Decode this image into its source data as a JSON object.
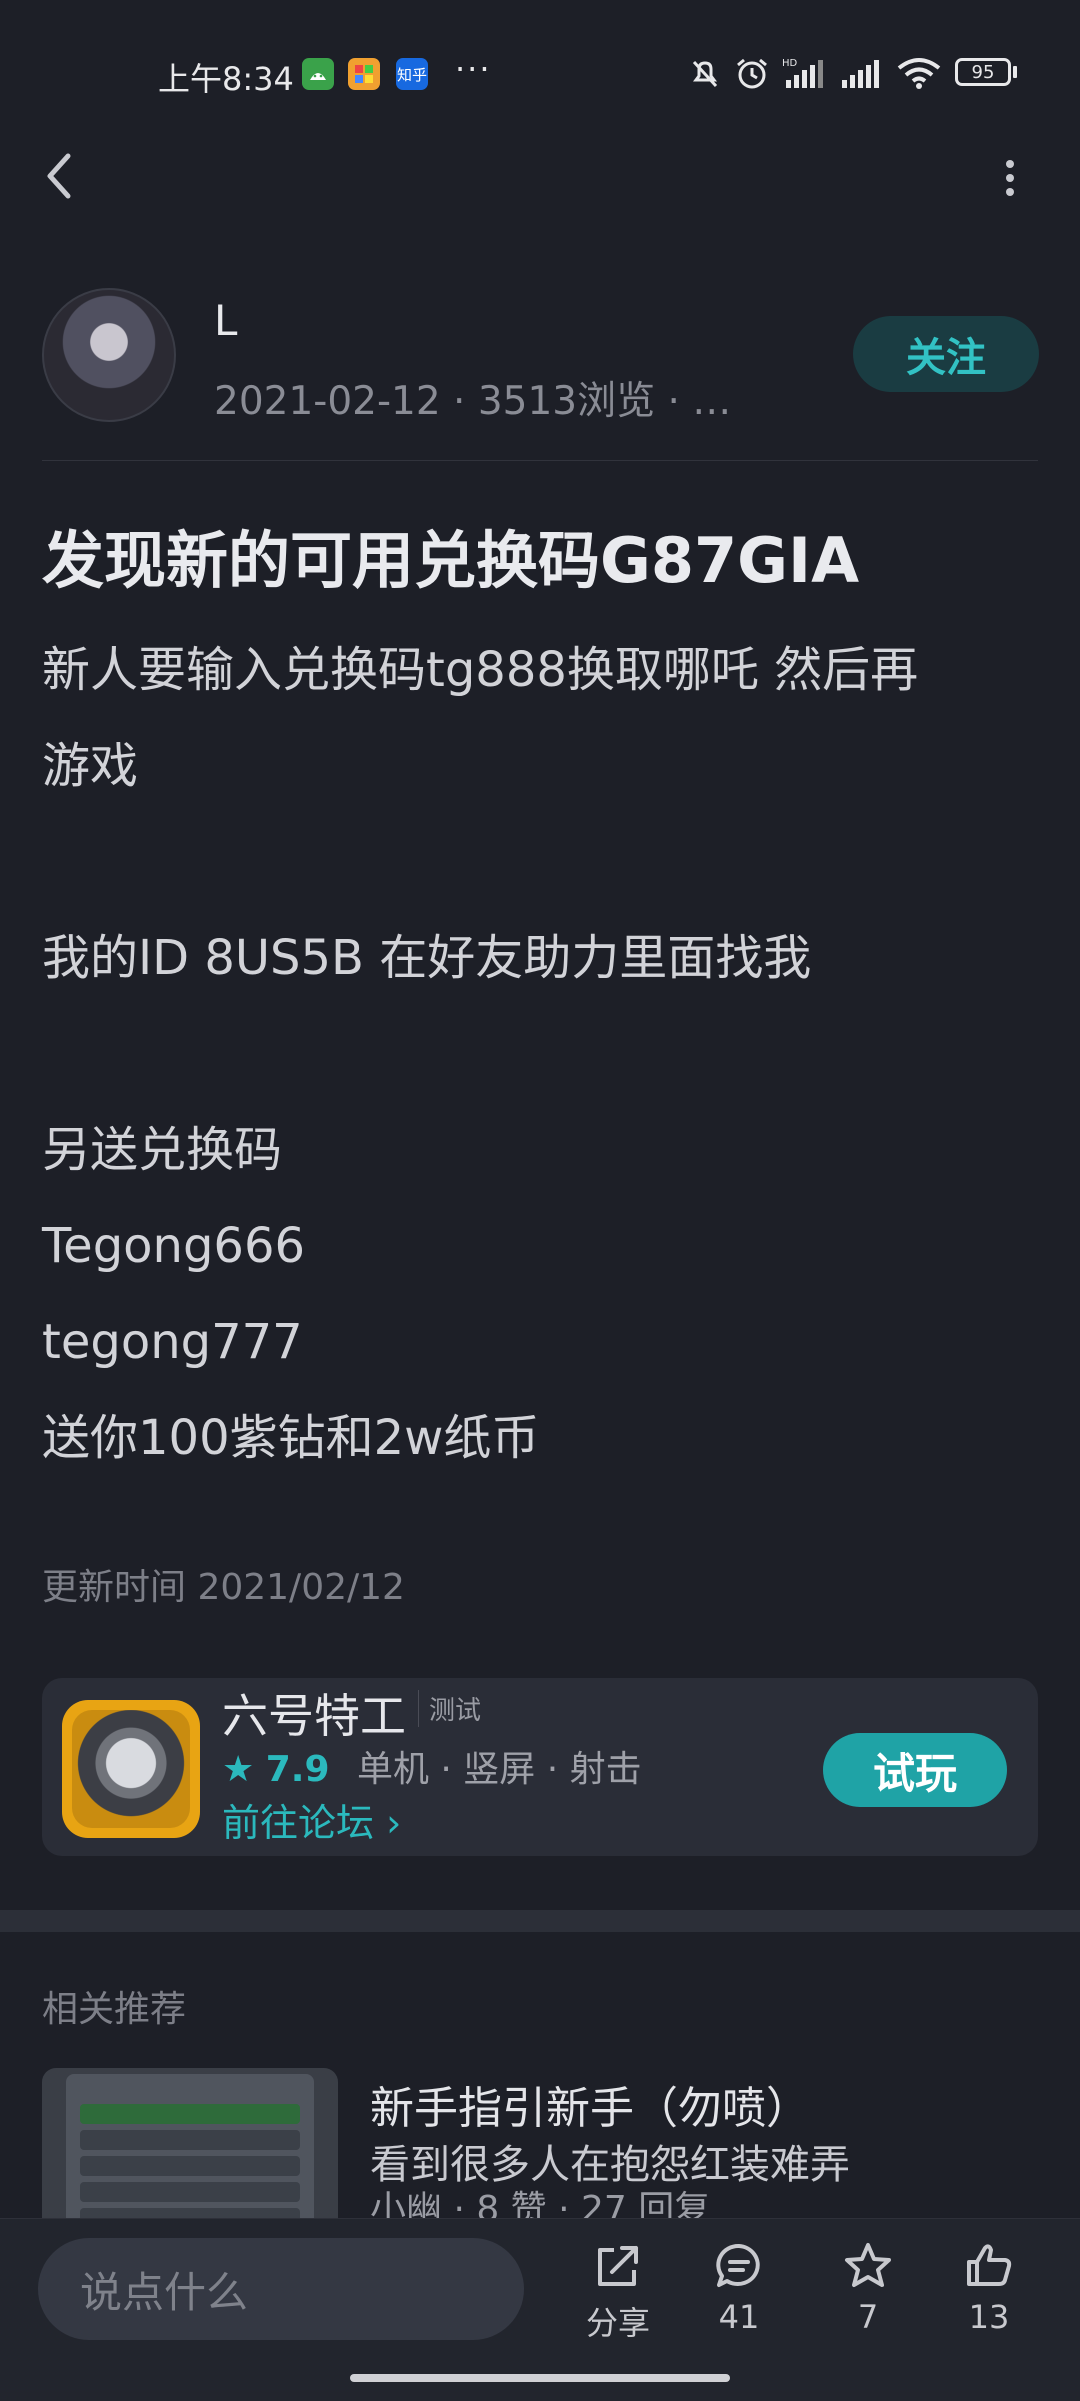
{
  "status_bar": {
    "time": "上午8:34",
    "apps": [
      {
        "icon": "android-app-icon",
        "label": "",
        "color": "#3aa24a"
      },
      {
        "icon": "colorful-app-icon",
        "label": "",
        "color": "#e07a1f"
      },
      {
        "icon": "zhihu-icon",
        "label": "知乎",
        "color": "#1769e0"
      }
    ],
    "overflow": "···",
    "battery": "95"
  },
  "nav": {
    "back_icon": "chevron-left-icon",
    "more_icon": "more-vertical-icon"
  },
  "author": {
    "name": "L",
    "meta": "2021-02-12 · 3513浏览 · …",
    "follow_label": "关注"
  },
  "post": {
    "title": "发现新的可用兑换码G87GIA",
    "body_lines": [
      "新人要输入兑换码tg888换取哪吒 然后再",
      "游戏",
      "",
      "我的ID 8US5B 在好友助力里面找我",
      "",
      "另送兑换码",
      "Tegong666",
      "tegong777",
      "送你100紫钻和2w纸币"
    ],
    "updated": "更新时间 2021/02/12"
  },
  "game": {
    "name": "六号特工",
    "tag": "测试",
    "rating": "7.9",
    "meta": "单机 · 竖屏 · 射击",
    "forum_link": "前往论坛",
    "try_label": "试玩"
  },
  "related": {
    "section_title": "相关推荐",
    "item": {
      "title": "新手指引新手（勿喷）",
      "subtitle": "看到很多人在抱怨红装难弄",
      "meta": "小幽 · 8 赞 · 27 回复"
    }
  },
  "bottom_bar": {
    "comment_placeholder": "说点什么",
    "share_label": "分享",
    "comments_count": "41",
    "favorites_count": "7",
    "likes_count": "13"
  },
  "colors": {
    "background": "#1d1f27",
    "accent": "#2bb9bd",
    "card": "#2a2d37"
  }
}
